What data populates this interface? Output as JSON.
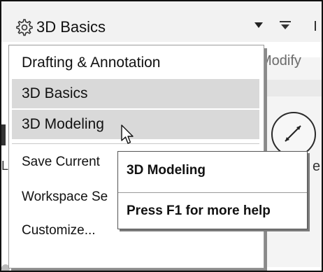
{
  "workspace": {
    "current": "3D Basics",
    "caret_icon": "chevron-down-icon",
    "gear_icon": "gear-icon"
  },
  "background": {
    "ribbon_tab": "Modify",
    "right_letter": "e"
  },
  "menu": {
    "items": [
      {
        "label": "Drafting & Annotation",
        "state": "normal"
      },
      {
        "label": "3D Basics",
        "state": "selected"
      },
      {
        "label": "3D Modeling",
        "state": "hover"
      }
    ],
    "commands": [
      {
        "label": "Save Current"
      },
      {
        "label": "Workspace Se"
      },
      {
        "label": "Customize..."
      }
    ]
  },
  "tooltip": {
    "title": "3D Modeling",
    "help": "Press F1 for more help"
  },
  "colors": {
    "highlight": "#d9d9d9",
    "border": "#9a9a9a"
  }
}
